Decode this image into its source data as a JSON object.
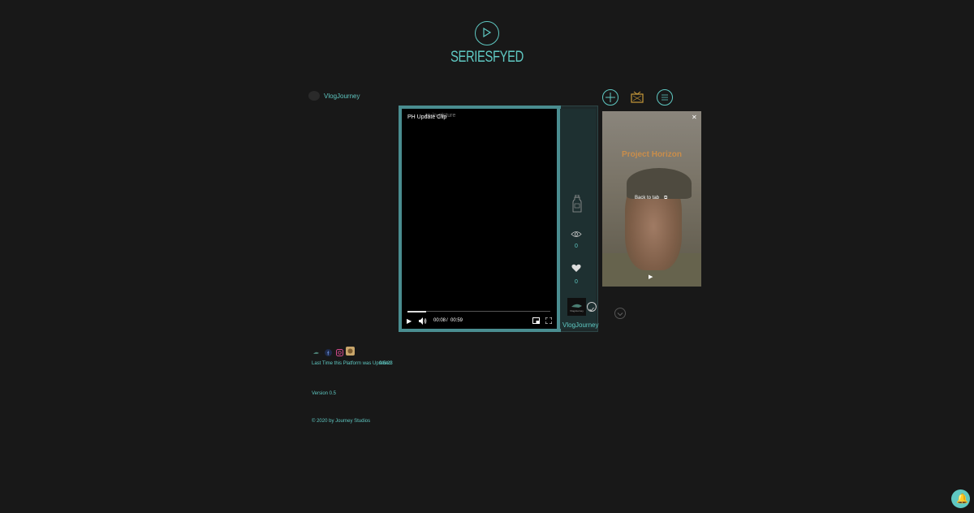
{
  "header": {
    "brand": "SERIESFYED"
  },
  "top_bar": {
    "username": "VlogJourney"
  },
  "player": {
    "clip_title": "PH Update Clip",
    "pip_overlay_text": "re-in-picture",
    "current_time": "00:08",
    "separator": "/",
    "duration": "00:59",
    "progress": 0.13,
    "view_count": "0",
    "like_count": "0",
    "channel_name": "VlogJourney",
    "channel_thumb_label": "VlogJourney"
  },
  "pip_window": {
    "wall_text": "Project Horizon",
    "back_to_tab": "Back to tab"
  },
  "footer": {
    "updated_label": "Last Time this Platform was Updated:",
    "updated_date": "9/5/23",
    "version": "Version 0.5",
    "copyright": "© 2020 by Journey Studios"
  },
  "colors": {
    "accent": "#5fc8c2",
    "background": "#181818"
  }
}
